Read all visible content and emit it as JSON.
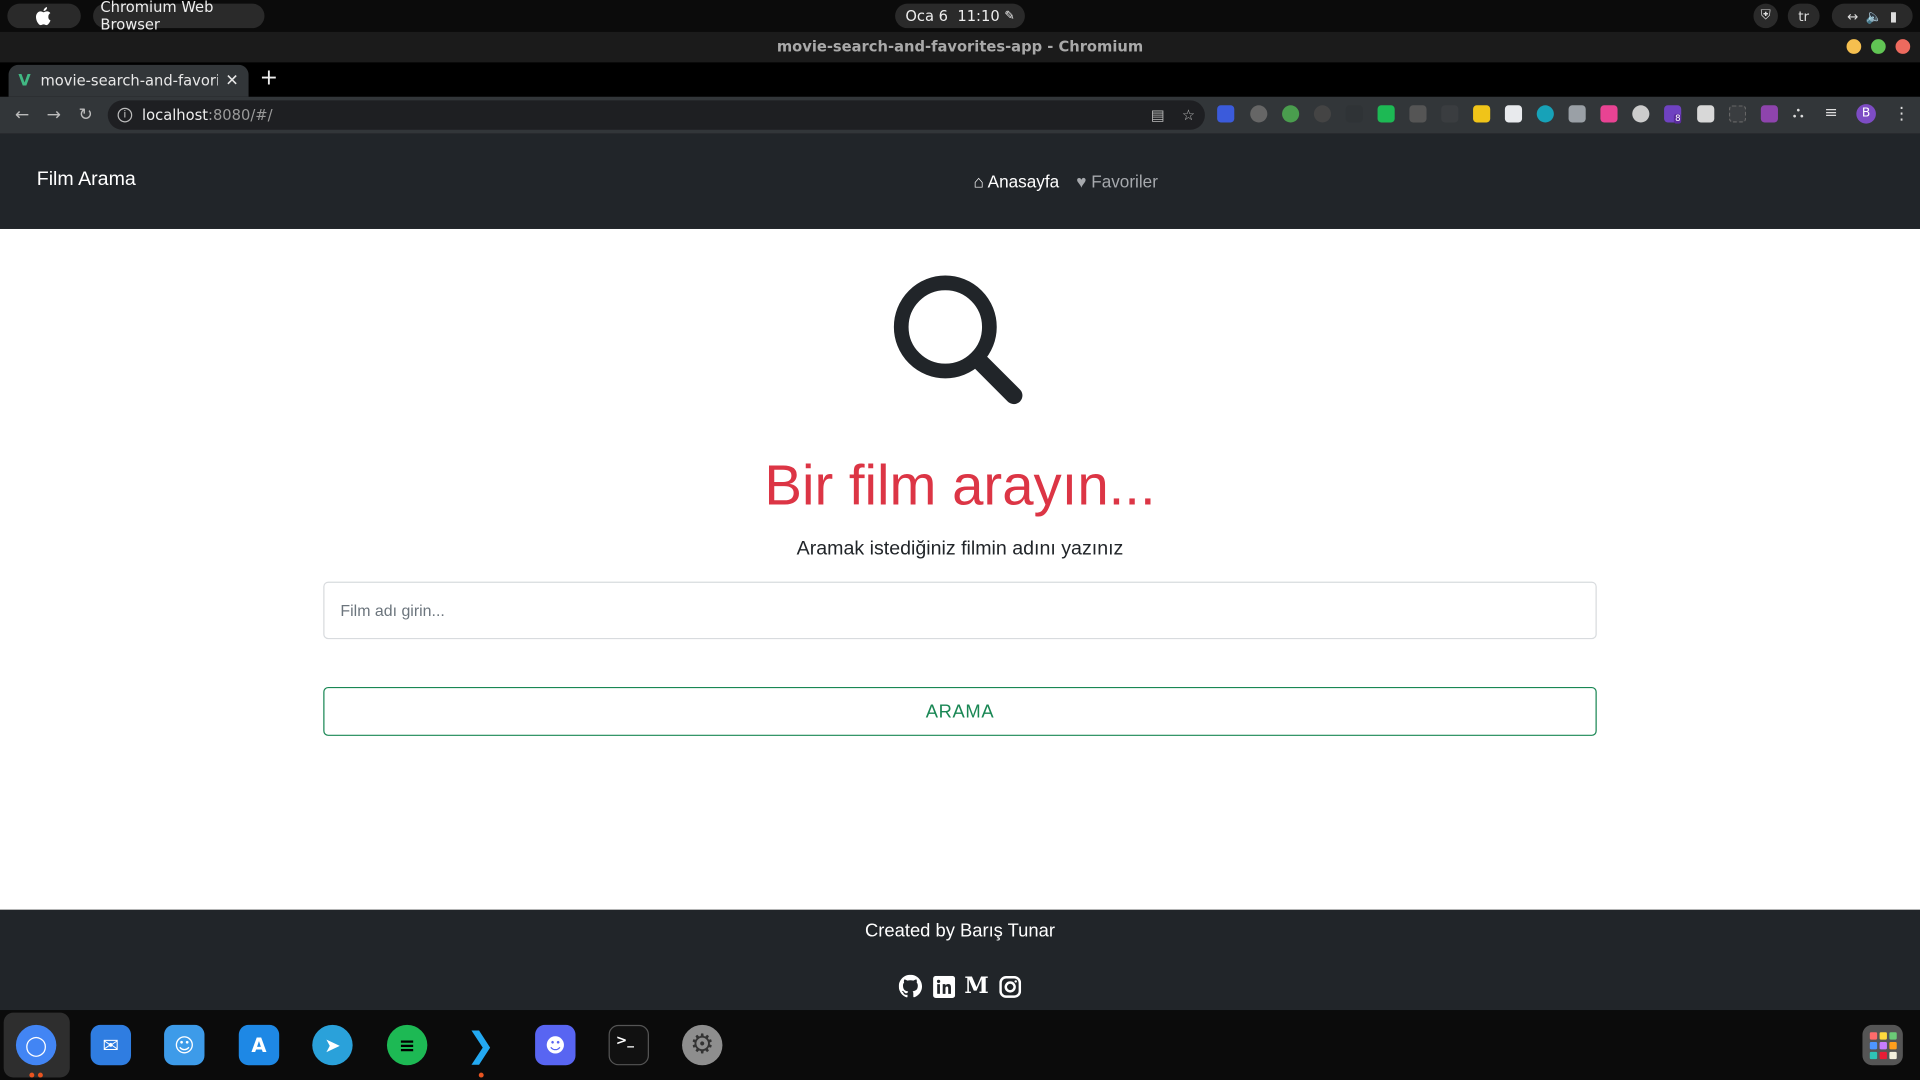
{
  "system": {
    "app_menu": "Chromium Web Browser",
    "clock_date": "Oca 6",
    "clock_time": "11:10",
    "lang": "tr"
  },
  "window": {
    "title": "movie-search-and-favorites-app - Chromium"
  },
  "browser": {
    "tab_title": "movie-search-and-favorites-app",
    "url_host": "localhost",
    "url_rest": ":8080/#/",
    "extension_badge": "8",
    "profile_initial": "B"
  },
  "navbar": {
    "brand": "Film Arama",
    "home": "Anasayfa",
    "favorites": "Favoriler"
  },
  "main": {
    "heading": "Bir film arayın...",
    "subtitle": "Aramak istediğiniz filmin adını yazınız",
    "search_placeholder": "Film adı girin...",
    "search_value": "",
    "search_button": "ARAMA"
  },
  "footer": {
    "credit": "Created by Barış Tunar",
    "socials": [
      "github-icon",
      "linkedin-icon",
      "medium-icon",
      "instagram-icon"
    ]
  },
  "dock": {
    "apps": [
      "chromium",
      "mail",
      "finder",
      "app-store",
      "telegram",
      "spotify",
      "vscode",
      "discord",
      "terminal",
      "settings",
      "launchpad"
    ]
  },
  "colors": {
    "navbar_bg": "#212529",
    "heading": "#dc3545",
    "button": "#198754"
  }
}
